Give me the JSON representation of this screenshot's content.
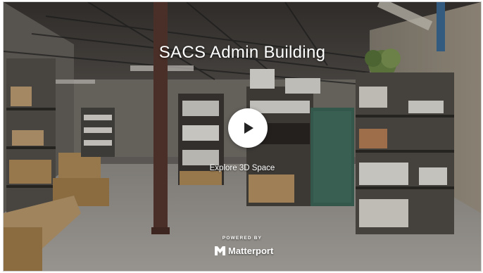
{
  "viewer": {
    "title": "SACS Admin Building",
    "explore_label": "Explore 3D Space",
    "powered_by": "POWERED BY",
    "brand_name": "Matterport"
  },
  "icons": {
    "play": "play-icon",
    "brand_logo": "matterport-logo-icon"
  },
  "colors": {
    "text": "#ffffff",
    "button_bg": "#ffffff",
    "button_icon": "#222222"
  }
}
